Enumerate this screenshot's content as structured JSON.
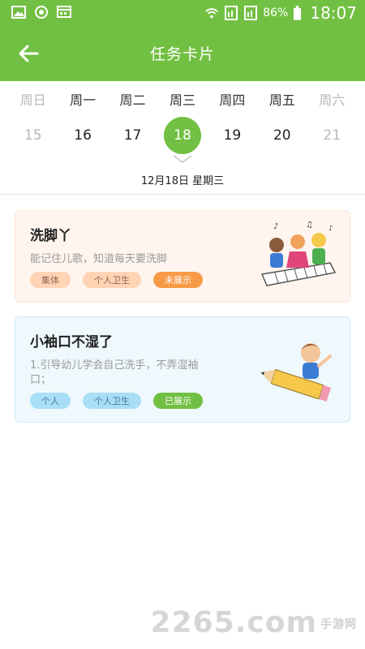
{
  "status_bar": {
    "battery_percent": "86%",
    "time": "18:07",
    "icons": [
      "gallery-icon",
      "sync-icon",
      "calendar-grid-icon",
      "wifi-icon",
      "sim1-icon",
      "sim2-icon",
      "battery-icon"
    ]
  },
  "header": {
    "title": "任务卡片",
    "back_icon": "arrow-left-icon"
  },
  "calendar": {
    "days": [
      {
        "weekday": "周日",
        "date": "15",
        "muted": true,
        "selected": false
      },
      {
        "weekday": "周一",
        "date": "16",
        "muted": false,
        "selected": false
      },
      {
        "weekday": "周二",
        "date": "17",
        "muted": false,
        "selected": false
      },
      {
        "weekday": "周三",
        "date": "18",
        "muted": false,
        "selected": true
      },
      {
        "weekday": "周四",
        "date": "19",
        "muted": false,
        "selected": false
      },
      {
        "weekday": "周五",
        "date": "20",
        "muted": false,
        "selected": false
      },
      {
        "weekday": "周六",
        "date": "21",
        "muted": true,
        "selected": false
      }
    ],
    "selected_date_label": "12月18日 星期三"
  },
  "cards": [
    {
      "title": "洗脚丫",
      "description": "能记住儿歌，知道每天要洗脚",
      "tags": [
        "集体",
        "个人卫生",
        "未展示"
      ]
    },
    {
      "title": "小袖口不湿了",
      "description": "1.引导幼儿学会自己洗手，不弄湿袖口；",
      "tags": [
        "个人",
        "个人卫生",
        "已展示"
      ]
    }
  ],
  "watermark": {
    "brand": "2265",
    "suffix": ".com",
    "sub": "手游网"
  },
  "colors": {
    "accent_green": "#72c043",
    "card1_bg": "#fff5ee",
    "card2_bg": "#eef8fd",
    "tag_orange": "#f79a46"
  }
}
